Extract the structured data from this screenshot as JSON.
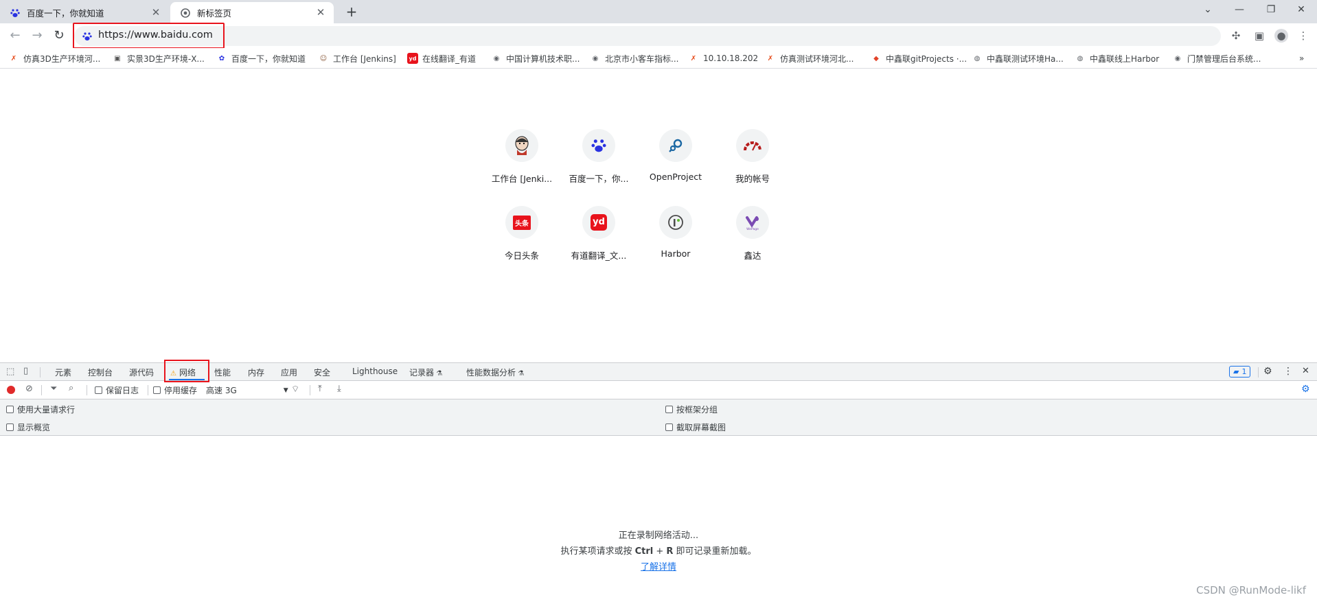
{
  "tabs": [
    {
      "title": "百度一下，你就知道",
      "icon": "baidu-paw-icon"
    },
    {
      "title": "新标签页",
      "icon": "chrome-globe-icon"
    }
  ],
  "address": {
    "url": "https://www.baidu.com"
  },
  "bookmarks": [
    {
      "label": "仿真3D生产环境河...",
      "icon": "x-logo-icon"
    },
    {
      "label": "实景3D生产环境-X...",
      "icon": "image-icon"
    },
    {
      "label": "百度一下，你就知道",
      "icon": "baidu-paw-icon"
    },
    {
      "label": "工作台 [Jenkins]",
      "icon": "jenkins-icon"
    },
    {
      "label": "在线翻译_有道",
      "icon": "youdao-icon"
    },
    {
      "label": "中国计算机技术职...",
      "icon": "globe-icon"
    },
    {
      "label": "北京市小客车指标...",
      "icon": "globe-icon"
    },
    {
      "label": "10.10.18.202",
      "icon": "x-logo-icon"
    },
    {
      "label": "仿真测试环境河北...",
      "icon": "x-logo-icon"
    },
    {
      "label": "中鑫联gitProjects ·...",
      "icon": "gitlab-icon"
    },
    {
      "label": "中鑫联测试环境Ha...",
      "icon": "harbor-icon"
    },
    {
      "label": "中鑫联线上Harbor",
      "icon": "harbor-icon"
    },
    {
      "label": "门禁管理后台系统...",
      "icon": "globe-icon"
    }
  ],
  "shortcuts": [
    {
      "label": "工作台 [Jenki...",
      "icon": "jenkins-icon"
    },
    {
      "label": "百度一下，你...",
      "icon": "baidu-paw-icon"
    },
    {
      "label": "OpenProject",
      "icon": "openproject-icon"
    },
    {
      "label": "我的帐号",
      "icon": "account-gauge-icon"
    },
    {
      "label": "今日头条",
      "icon": "toutiao-icon",
      "badge": "头条"
    },
    {
      "label": "有道翻译_文...",
      "icon": "youdao-icon",
      "badge": "yd"
    },
    {
      "label": "Harbor",
      "icon": "harbor-icon"
    },
    {
      "label": "鑫达",
      "icon": "wepage-icon",
      "badge": "WePage"
    }
  ],
  "devtools": {
    "tabs": [
      "元素",
      "控制台",
      "源代码",
      "网络",
      "性能",
      "内存",
      "应用",
      "安全",
      "Lighthouse",
      "记录器",
      "性能数据分析"
    ],
    "issues_count": "1",
    "bar": {
      "preserve_log": "保留日志",
      "disable_cache": "停用缓存",
      "throttle": "高速 3G"
    },
    "options": {
      "large_rows": "使用大量请求行",
      "overview": "显示概览",
      "group_by_frame": "按框架分组",
      "screenshots": "截取屏幕截图"
    },
    "empty": {
      "line1": "正在录制网络活动...",
      "line2_prefix": "执行某项请求或按 ",
      "line2_key1": "Ctrl",
      "line2_plus": " + ",
      "line2_key2": "R",
      "line2_suffix": " 即可记录重新加载。",
      "learn_more": "了解详情"
    }
  },
  "watermark": "CSDN @RunMode-likf",
  "colors": {
    "highlight_red": "#e8131c",
    "accent_blue": "#1a73e8",
    "record_red": "#e02a2a"
  }
}
